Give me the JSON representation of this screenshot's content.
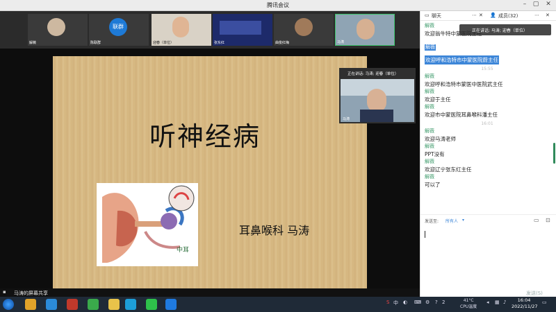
{
  "window": {
    "title": "腾讯会议"
  },
  "participants": [
    {
      "name": "解薇"
    },
    {
      "name": "陈联群",
      "avatar_text": "联群"
    },
    {
      "name": "迎春（单位）"
    },
    {
      "name": "张东红"
    },
    {
      "name": "曲俊红梅"
    },
    {
      "name": "马涛"
    }
  ],
  "slide": {
    "title": "听神经病",
    "author": "耳鼻喉科 马涛",
    "diagram_label": "中耳"
  },
  "pip": {
    "speaking": "正在讲话: 马涛; 迎春（单位）",
    "name": "马涛"
  },
  "share_bar": {
    "label": "马涛的屏幕共享"
  },
  "chat": {
    "tab_chat": "聊天",
    "tab_members": "成员(32)",
    "speaking_banner": "正在讲话: 马涛; 迎春（单位）",
    "messages": [
      {
        "sender": "解薇",
        "text": "欢迎翁牛特中蒙医院主任"
      },
      {
        "sender": "解薇",
        "text": "欢迎呼和浩特市中蒙医院蔚主任",
        "highlight": true
      },
      {
        "timestamp": "15:55"
      },
      {
        "sender": "解薇",
        "text": "欢迎呼和浩特市蒙医中医院武主任"
      },
      {
        "sender": "解薇",
        "text": "欢迎于主任"
      },
      {
        "sender": "解薇",
        "text": "欢迎市中蒙医院耳鼻喉科潘主任"
      },
      {
        "timestamp": "16:01"
      },
      {
        "sender": "解薇",
        "text": "欢迎马涛老师"
      },
      {
        "sender": "解薇",
        "text": "PPT没有"
      },
      {
        "sender": "解薇",
        "text": "欢迎辽宁张东红主任"
      },
      {
        "sender": "解薇",
        "text": "可以了"
      }
    ],
    "send_to_label": "发送至:",
    "send_to_value": "所有人",
    "send_button": "发送(S)"
  },
  "taskbar": {
    "temperature": "41°C",
    "cpu_label": "CPU温度",
    "time": "16:04",
    "date": "2022/11/27",
    "ime": "中",
    "notification_count": "2"
  }
}
